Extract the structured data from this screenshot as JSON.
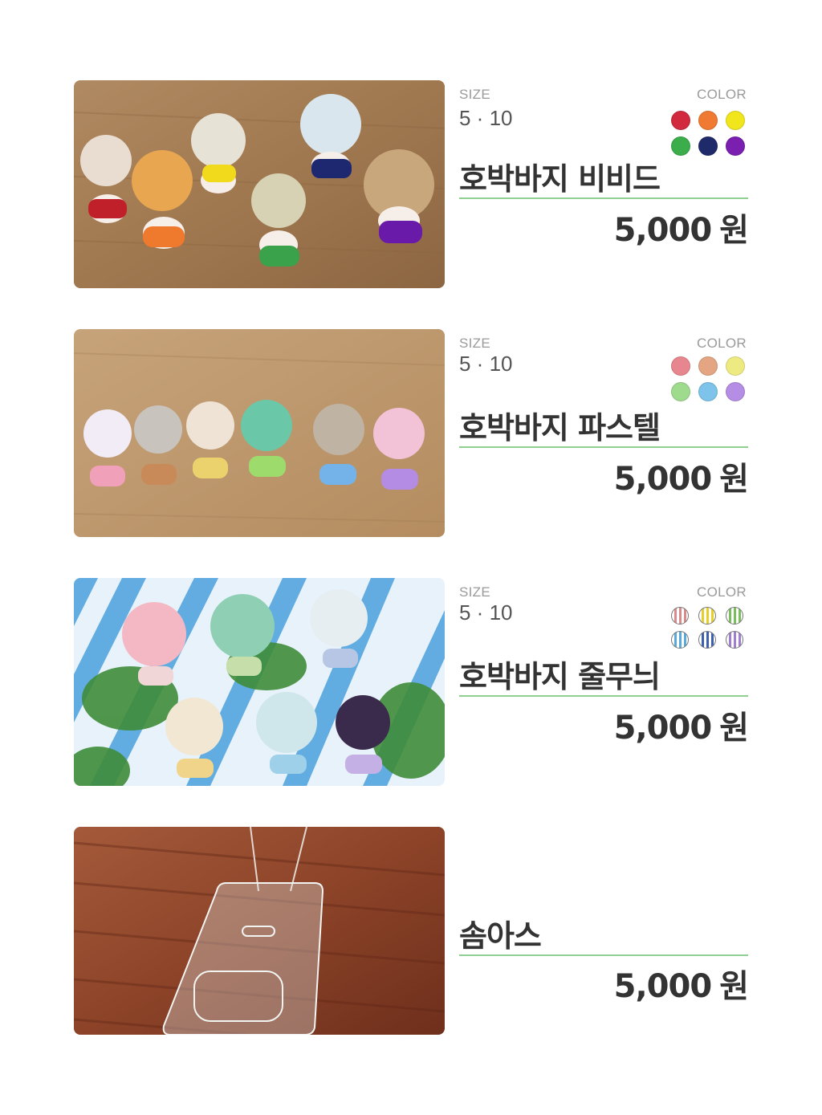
{
  "labels": {
    "size": "SIZE",
    "color": "COLOR"
  },
  "products": [
    {
      "name": "호박바지 비비드",
      "size": "5 · 10",
      "price": "5,000",
      "currency": "원",
      "photo_alt": "doll-photo-vivid",
      "swatch_style": "solid",
      "colors": [
        "#d12a3e",
        "#f07a32",
        "#f1e51c",
        "#3cad4b",
        "#1f2a6b",
        "#7a1fb0"
      ]
    },
    {
      "name": "호박바지 파스텔",
      "size": "5 · 10",
      "price": "5,000",
      "currency": "원",
      "photo_alt": "doll-photo-pastel",
      "swatch_style": "solid",
      "colors": [
        "#e8868f",
        "#e4a582",
        "#eeea82",
        "#9edb8d",
        "#7dc3ea",
        "#b68de4"
      ]
    },
    {
      "name": "호박바지 줄무늬",
      "size": "5 · 10",
      "price": "5,000",
      "currency": "원",
      "photo_alt": "doll-photo-stripe",
      "swatch_style": "stripe",
      "colors": [
        "#d98a8a",
        "#e7cf2a",
        "#7bbf5a",
        "#5aa9d9",
        "#3e5fb0",
        "#a07fd0"
      ]
    },
    {
      "name": "솜아스",
      "size": "",
      "price": "5,000",
      "currency": "원",
      "photo_alt": "acrylic-stand-photo",
      "swatch_style": "none",
      "colors": []
    }
  ]
}
